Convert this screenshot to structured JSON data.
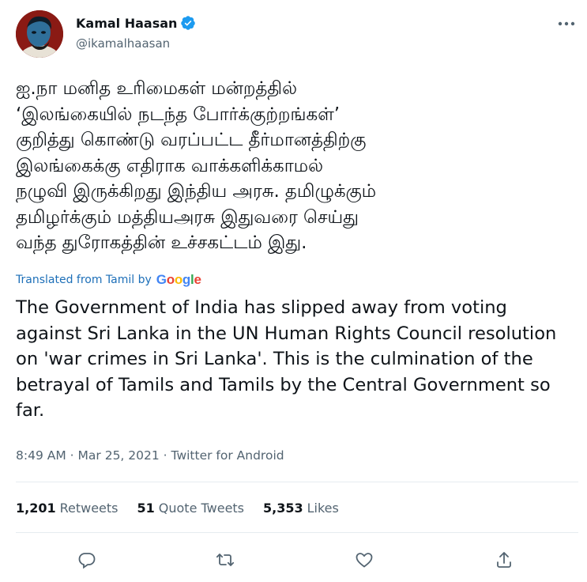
{
  "author": {
    "name": "Kamal Haasan",
    "handle": "@ikamalhaasan",
    "verified_icon": "verified-badge-icon",
    "avatar_icon": "avatar"
  },
  "tweet": {
    "tamil_text": "ஐ.நா மனித உரிமைகள் மன்றத்தில்\n‘இலங்கையில் நடந்த போர்க்குற்றங்கள்’\nகுறித்து கொண்டு வரப்பட்ட தீர்மானத்திற்கு\nஇலங்கைக்கு எதிராக வாக்களிக்காமல்\nநழுவி இருக்கிறது இந்திய அரசு. தமிழுக்கும்\nதமிழர்க்கும் மத்தியஅரசு இதுவரை செய்து\nவந்த துரோகத்தின் உச்சகட்டம் இது.",
    "translated_label": "Translated from Tamil by",
    "translator": "Google",
    "english_text": "The Government of India has slipped away from voting against Sri Lanka in the UN Human Rights Council resolution on 'war crimes in Sri Lanka'. This is the culmination of the betrayal of Tamils and Tamils by the Central Government so far."
  },
  "meta": {
    "time": "8:49 AM",
    "sep1": "·",
    "date": "Mar 25, 2021",
    "sep2": "·",
    "source": "Twitter for Android"
  },
  "stats": [
    {
      "count": "1,201",
      "label": "Retweets"
    },
    {
      "count": "51",
      "label": "Quote Tweets"
    },
    {
      "count": "5,353",
      "label": "Likes"
    }
  ],
  "actions": [
    "reply-icon",
    "retweet-icon",
    "like-icon",
    "share-icon"
  ],
  "colors": {
    "text": "#0f1419",
    "secondary": "#536471",
    "verified": "#1d9bf0",
    "divider": "#e6ecf0",
    "translated_link": "#1d6fb8"
  }
}
